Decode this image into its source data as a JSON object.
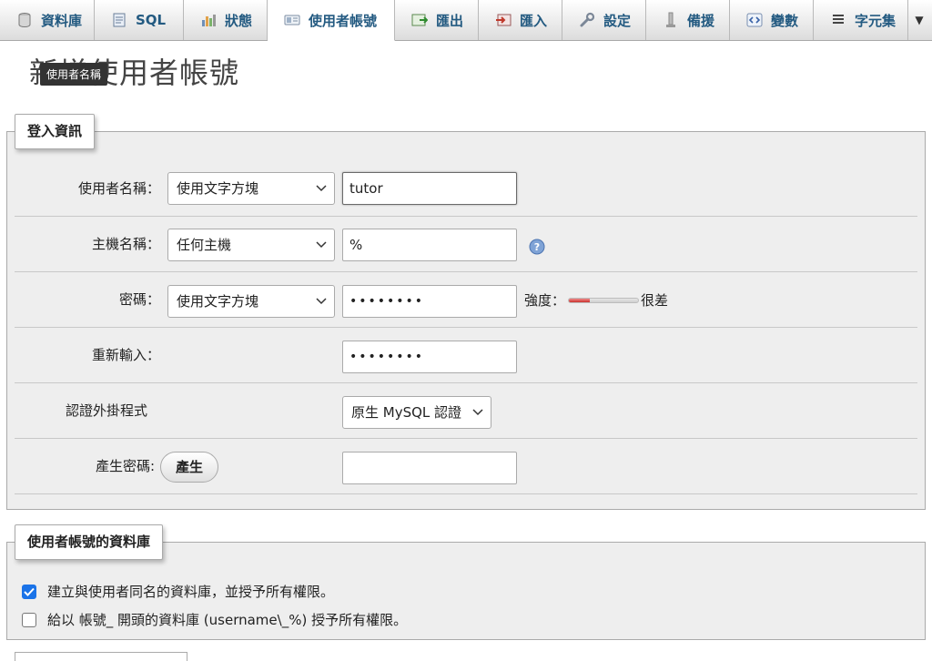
{
  "tabs": [
    {
      "label": "資料庫",
      "icon": "database-icon"
    },
    {
      "label": "SQL",
      "icon": "sql-icon"
    },
    {
      "label": "狀態",
      "icon": "status-icon"
    },
    {
      "label": "使用者帳號",
      "icon": "users-icon",
      "active": true
    },
    {
      "label": "匯出",
      "icon": "export-icon"
    },
    {
      "label": "匯入",
      "icon": "import-icon"
    },
    {
      "label": "設定",
      "icon": "wrench-icon"
    },
    {
      "label": "備援",
      "icon": "replication-icon"
    },
    {
      "label": "變數",
      "icon": "variables-icon"
    },
    {
      "label": "字元集",
      "icon": "charset-icon"
    }
  ],
  "page": {
    "title": "新增使用者帳號",
    "tooltip": "使用者名稱"
  },
  "login": {
    "legend": "登入資訊",
    "username": {
      "label": "使用者名稱：",
      "select": "使用文字方塊",
      "value": "tutor"
    },
    "hostname": {
      "label": "主機名稱：",
      "select": "任何主機",
      "value": "%"
    },
    "password": {
      "label": "密碼：",
      "select": "使用文字方塊",
      "value": "••••••••",
      "strength_label": "強度：",
      "strength_text": "很差",
      "strength_level": 0.3
    },
    "retype": {
      "label": "重新輸入：",
      "value": "••••••••"
    },
    "auth_plugin": {
      "label": "認證外掛程式",
      "select": "原生 MySQL 認證"
    },
    "generate": {
      "label": "產生密碼:",
      "button": "產生",
      "value": ""
    }
  },
  "database": {
    "legend": "使用者帳號的資料庫",
    "options": [
      {
        "label": "建立與使用者同名的資料庫，並授予所有權限。",
        "checked": true
      },
      {
        "label": "給以 帳號_ 開頭的資料庫 (username\\_%) 授予所有權限。",
        "checked": false
      }
    ]
  },
  "colors": {
    "accent": "#235a81",
    "checkbox": "#1a73e8",
    "strength_bar": "#c9302c"
  }
}
